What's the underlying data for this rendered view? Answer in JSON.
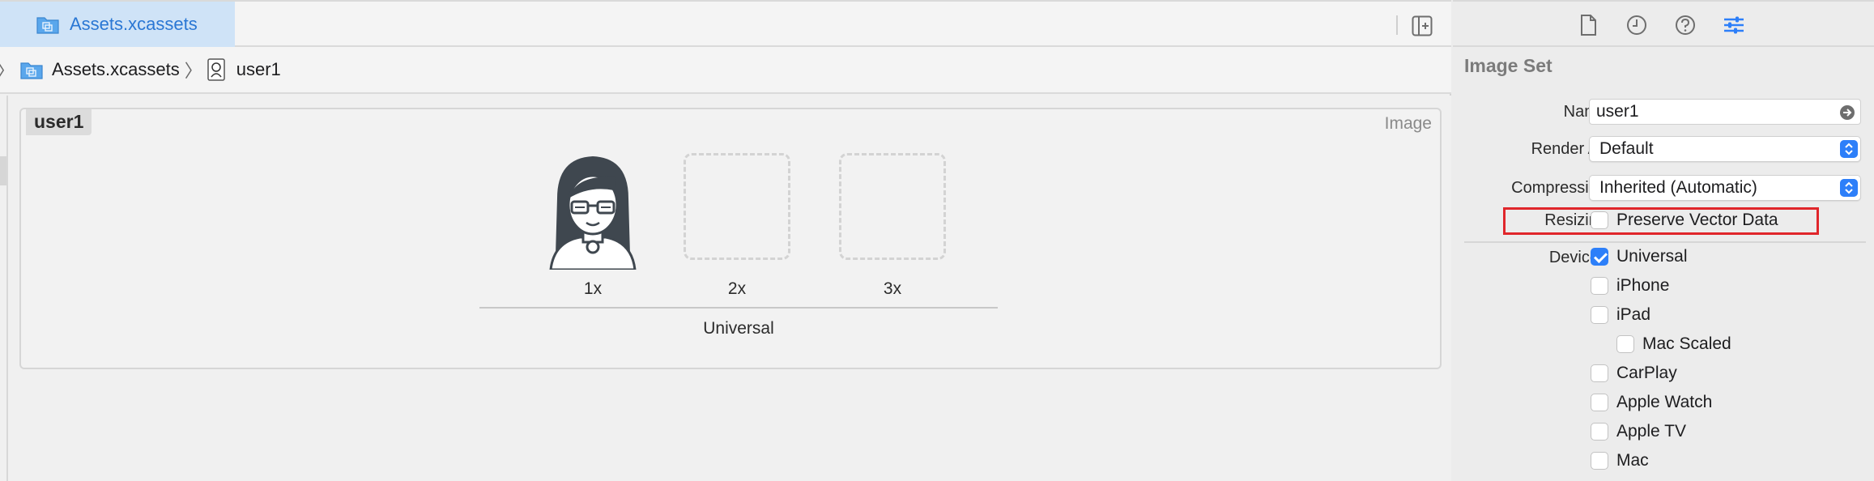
{
  "tab": {
    "label": "Assets.xcassets"
  },
  "breadcrumbs": [
    {
      "label": "Assets.xcassets"
    },
    {
      "label": "user1"
    }
  ],
  "asset": {
    "name": "user1",
    "kind": "Image",
    "slots": [
      "1x",
      "2x",
      "3x"
    ],
    "group": "Universal"
  },
  "inspector": {
    "header": "Image Set",
    "name_label": "Name",
    "name_value": "user1",
    "render_label": "Render As",
    "render_value": "Default",
    "compression_label": "Compression",
    "compression_value": "Inherited (Automatic)",
    "resizing_label": "Resizing",
    "resizing_option": "Preserve Vector Data",
    "devices_label": "Devices",
    "devices": [
      {
        "label": "Universal",
        "checked": true
      },
      {
        "label": "iPhone",
        "checked": false
      },
      {
        "label": "iPad",
        "checked": false
      },
      {
        "label": "Mac Scaled",
        "checked": false
      },
      {
        "label": "CarPlay",
        "checked": false
      },
      {
        "label": "Apple Watch",
        "checked": false
      },
      {
        "label": "Apple TV",
        "checked": false
      },
      {
        "label": "Mac",
        "checked": false
      }
    ]
  },
  "colors": {
    "accent": "#2d7ff9",
    "tab_active_bg": "#cfe3f7",
    "tab_active_text": "#2a77d4",
    "highlight": "#e0262b"
  },
  "icons": {
    "file_inspector": "file-icon",
    "history_inspector": "clock-icon",
    "help_inspector": "question-icon",
    "attributes_inspector": "sliders-icon",
    "split_editor": "add-editor-icon",
    "folder": "folder-icon"
  }
}
